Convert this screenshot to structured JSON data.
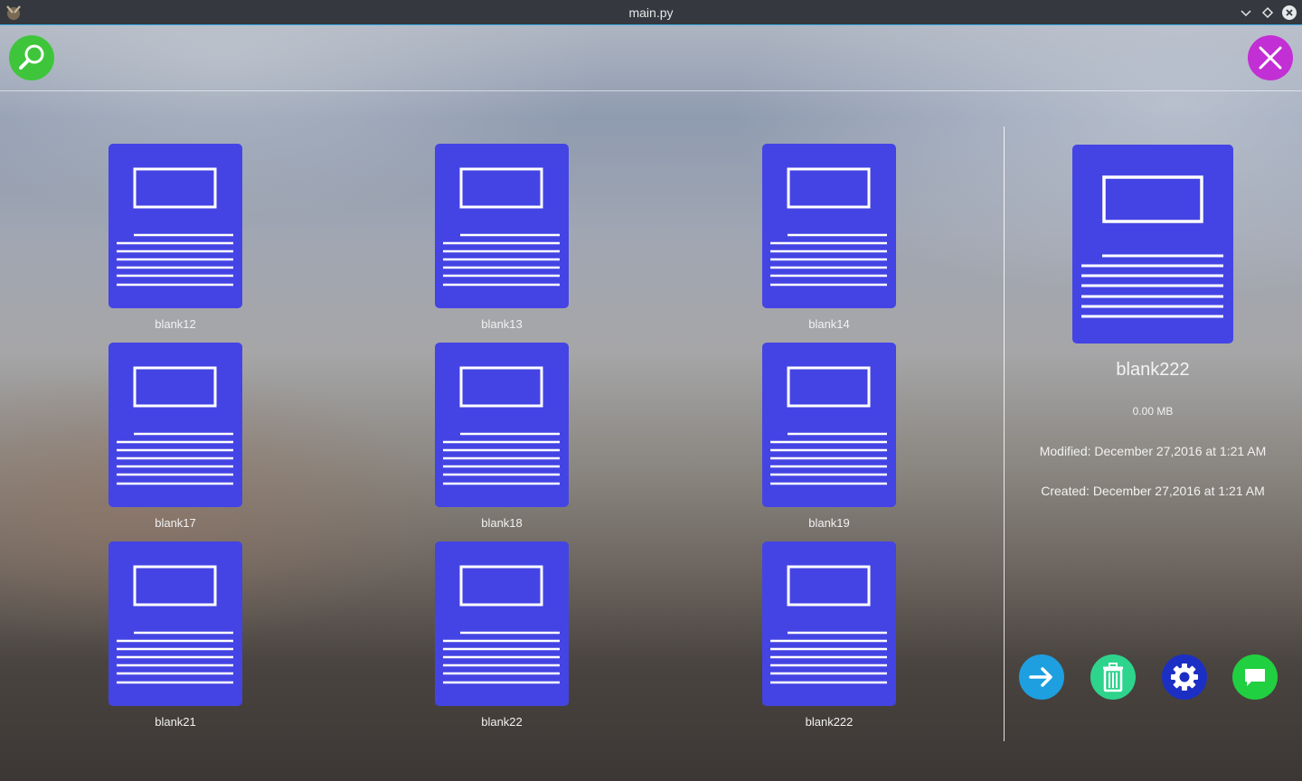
{
  "window": {
    "title": "main.py"
  },
  "colors": {
    "doc_fill": "#4444e4",
    "search_button": "#3fc53b",
    "close_button": "#c22fd4",
    "open_button": "#1e9fe0",
    "delete_button": "#2ed48c",
    "settings_button": "#1c2fc4",
    "comment_button": "#20d040"
  },
  "toolbar": {
    "search_icon": "search-icon",
    "close_icon": "close-icon"
  },
  "files": [
    {
      "name": "blank12"
    },
    {
      "name": "blank13"
    },
    {
      "name": "blank14"
    },
    {
      "name": "blank17"
    },
    {
      "name": "blank18"
    },
    {
      "name": "blank19"
    },
    {
      "name": "blank21"
    },
    {
      "name": "blank22"
    },
    {
      "name": "blank222"
    }
  ],
  "details": {
    "name": "blank222",
    "size": "0.00 MB",
    "modified": "Modified: December 27,2016 at  1:21 AM",
    "created": "Created: December 27,2016 at  1:21 AM"
  },
  "actions": [
    {
      "icon": "arrow-right-icon"
    },
    {
      "icon": "trash-icon"
    },
    {
      "icon": "gear-icon"
    },
    {
      "icon": "comment-icon"
    }
  ]
}
